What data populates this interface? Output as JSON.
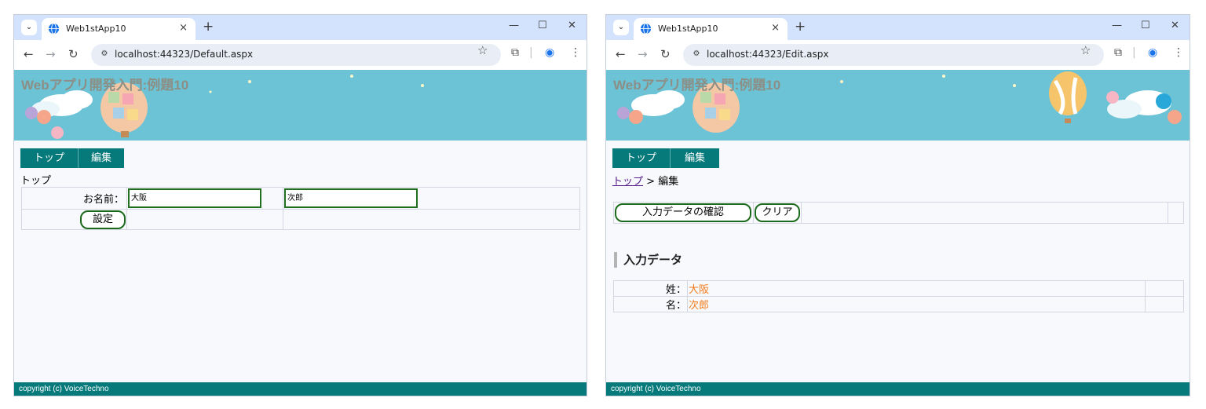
{
  "window_left": {
    "tab_title": "Web1stApp10",
    "url": "localhost:44323/Default.aspx",
    "site_title": "Webアプリ開発入門:例題10",
    "menu": [
      "トップ",
      "編集"
    ],
    "page_title": "トップ",
    "form": {
      "name_label": "お名前：",
      "last_name_value": "大阪",
      "first_name_value": "次郎",
      "set_button": "設定"
    },
    "footer": "copyright (c) VoiceTechno"
  },
  "window_right": {
    "tab_title": "Web1stApp10",
    "url": "localhost:44323/Edit.aspx",
    "site_title": "Webアプリ開発入門:例題10",
    "menu": [
      "トップ",
      "編集"
    ],
    "breadcrumb": {
      "link": "トップ",
      "separator": ">",
      "current": "編集"
    },
    "buttons": {
      "confirm": "入力データの確認",
      "clear": "クリア"
    },
    "section_title": "入力データ",
    "data_rows": [
      {
        "label": "姓：",
        "value": "大阪"
      },
      {
        "label": "名：",
        "value": "次郎"
      }
    ],
    "footer": "copyright (c) VoiceTechno"
  },
  "browser": {
    "tab_menu_icon": "chevron-down-icon",
    "new_tab_glyph": "+",
    "close_tab_glyph": "×",
    "minimize_glyph": "—",
    "maximize_glyph": "☐",
    "close_glyph": "✕"
  },
  "colors": {
    "nav_teal": "#06797a",
    "banner_sky": "#6cc3d6",
    "value_orange": "#f07a1a",
    "button_border_green": "#1c6b1c"
  }
}
